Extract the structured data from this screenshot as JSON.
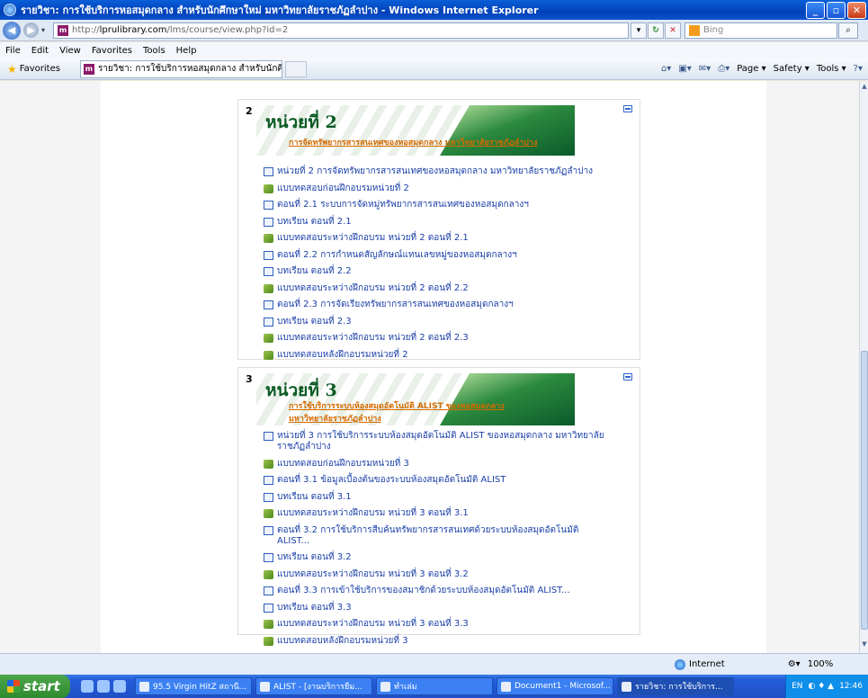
{
  "window": {
    "title": "รายวิชา: การใช้บริการหอสมุดกลาง สำหรับนักศึกษาใหม่ มหาวิทยาลัยราชภัฏลำปาง - Windows Internet Explorer"
  },
  "address": {
    "prefix": "http://",
    "domain": "lprulibrary.com",
    "path": "/lms/course/view.php?id=2",
    "search_placeholder": "Bing"
  },
  "menu": [
    "File",
    "Edit",
    "View",
    "Favorites",
    "Tools",
    "Help"
  ],
  "favorites": {
    "label": "Favorites",
    "tab_title": "รายวิชา: การใช้บริการหอสมุดกลาง สำหรับนักศึกษาใหม่ ...",
    "commands": [
      "Page ▾",
      "Safety ▾",
      "Tools ▾"
    ]
  },
  "sections": [
    {
      "number": "2",
      "banner_title": "หน่วยที่ 2",
      "banner_lines": [
        "การจัดทรัพยากรสารสนเทศของหอสมุดกลาง มหาวิทยาลัยราชภัฏลำปาง"
      ],
      "activities": [
        {
          "type": "resource",
          "text": "หน่วยที่ 2 การจัดทรัพยากรสารสนเทศของหอสมุดกลาง มหาวิทยาลัยราชภัฏลำปาง"
        },
        {
          "type": "quiz",
          "text": "แบบทดสอบก่อนฝึกอบรมหน่วยที่ 2"
        },
        {
          "type": "resource",
          "text": "ตอนที่ 2.1 ระบบการจัดหมู่ทรัพยากรสารสนเทศของหอสมุดกลางฯ"
        },
        {
          "type": "resource",
          "text": "บทเรียน ตอนที่ 2.1"
        },
        {
          "type": "quiz",
          "text": "แบบทดสอบระหว่างฝึกอบรม หน่วยที่ 2 ตอนที่ 2.1"
        },
        {
          "type": "resource",
          "text": "ตอนที่ 2.2 การกำหนดสัญลักษณ์แทนเลขหมู่ของหอสมุดกลางฯ"
        },
        {
          "type": "resource",
          "text": "บทเรียน ตอนที่ 2.2"
        },
        {
          "type": "quiz",
          "text": "แบบทดสอบระหว่างฝึกอบรม หน่วยที่ 2 ตอนที่ 2.2"
        },
        {
          "type": "resource",
          "text": "ตอนที่ 2.3 การจัดเรียงทรัพยากรสารสนเทศของหอสมุดกลางฯ"
        },
        {
          "type": "resource",
          "text": "บทเรียน ตอนที่ 2.3"
        },
        {
          "type": "quiz",
          "text": "แบบทดสอบระหว่างฝึกอบรม หน่วยที่ 2 ตอนที่ 2.3"
        },
        {
          "type": "quiz",
          "text": "แบบทดสอบหลังฝึกอบรมหน่วยที่ 2"
        }
      ]
    },
    {
      "number": "3",
      "banner_title": "หน่วยที่ 3",
      "banner_lines": [
        "การใช้บริการระบบห้องสมุดอัตโนมัติ ALIST ของหอสมุดกลาง",
        "มหาวิทยาลัยราชภัฏลำปาง"
      ],
      "activities": [
        {
          "type": "resource",
          "text": "หน่วยที่ 3 การใช้บริการระบบห้องสมุดอัตโนมัติ ALIST ของหอสมุดกลาง มหาวิทยาลัยราชภัฏลำปาง"
        },
        {
          "type": "quiz",
          "text": "แบบทดสอบก่อนฝึกอบรมหน่วยที่ 3"
        },
        {
          "type": "resource",
          "text": "ตอนที่ 3.1 ข้อมูลเบื้องต้นของระบบห้องสมุดอัตโนมัติ ALIST"
        },
        {
          "type": "resource",
          "text": "บทเรียน ตอนที่ 3.1"
        },
        {
          "type": "quiz",
          "text": "แบบทดสอบระหว่างฝึกอบรม หน่วยที่ 3 ตอนที่ 3.1"
        },
        {
          "type": "resource",
          "text": "ตอนที่ 3.2 การใช้บริการสืบค้นทรัพยากรสารสนเทศด้วยระบบห้องสมุดอัตโนมัติ ALIST..."
        },
        {
          "type": "resource",
          "text": "บทเรียน ตอนที่ 3.2"
        },
        {
          "type": "quiz",
          "text": "แบบทดสอบระหว่างฝึกอบรม หน่วยที่ 3 ตอนที่ 3.2"
        },
        {
          "type": "resource",
          "text": "ตอนที่ 3.3 การเข้าใช้บริการของสมาชิกด้วยระบบห้องสมุดอัตโนมัติ ALIST..."
        },
        {
          "type": "resource",
          "text": "บทเรียน ตอนที่ 3.3"
        },
        {
          "type": "quiz",
          "text": "แบบทดสอบระหว่างฝึกอบรม หน่วยที่ 3 ตอนที่ 3.3"
        },
        {
          "type": "quiz",
          "text": "แบบทดสอบหลังฝึกอบรมหน่วยที่ 3"
        }
      ]
    }
  ],
  "status": {
    "zone": "Internet",
    "zoom": "100%"
  },
  "taskbar": {
    "start": "start",
    "tasks": [
      "95.5 Virgin HitZ สถานี...",
      "ALIST - [งานบริการยืม...",
      "ทำเล่ม",
      "Document1 - Microsof...",
      "รายวิชา: การใช้บริการ..."
    ],
    "lang": "EN",
    "clock": "12:46"
  }
}
